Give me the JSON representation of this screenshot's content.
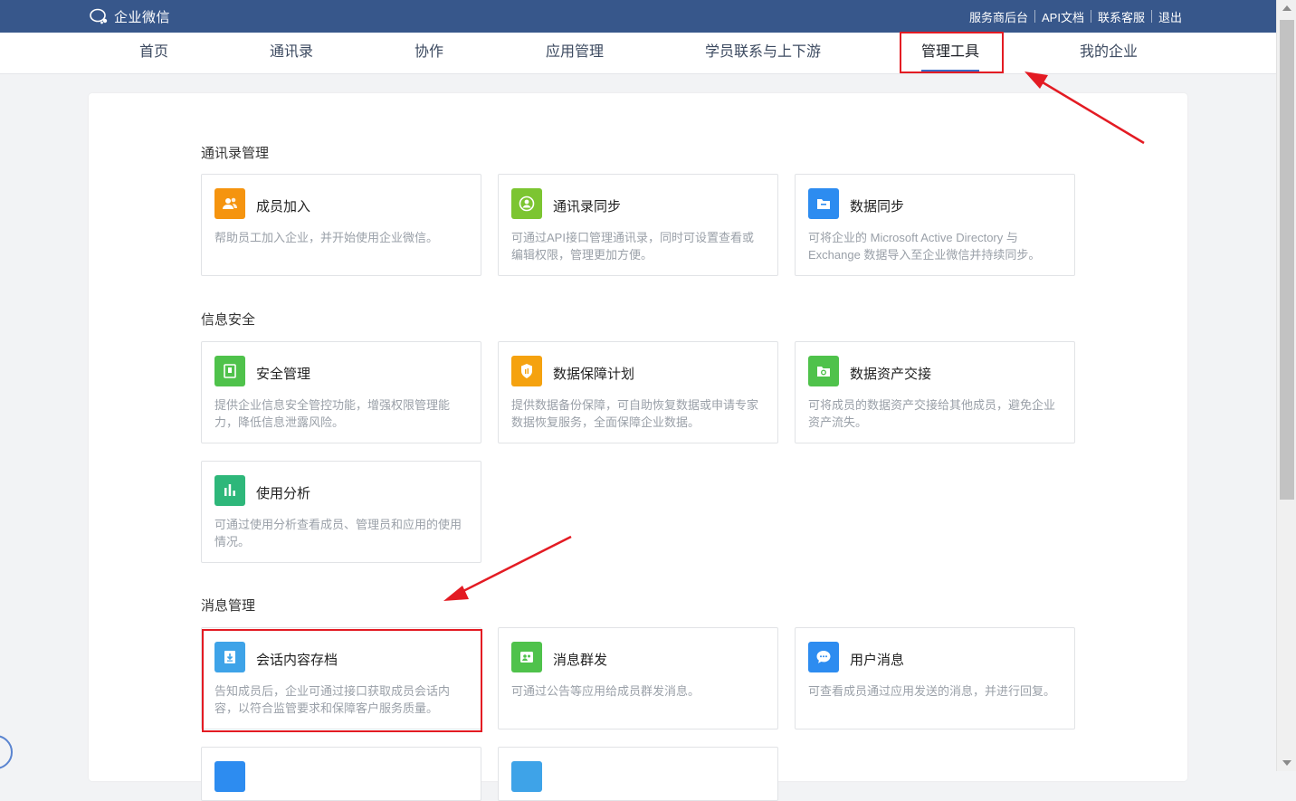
{
  "topbar": {
    "logo_text": "企业微信",
    "links": [
      "服务商后台",
      "API文档",
      "联系客服",
      "退出"
    ]
  },
  "nav": {
    "items": [
      "首页",
      "通讯录",
      "协作",
      "应用管理",
      "学员联系与上下游",
      "管理工具",
      "我的企业"
    ],
    "active": "管理工具"
  },
  "sections": {
    "contacts": {
      "title": "通讯录管理",
      "cards": [
        {
          "title": "成员加入",
          "desc": "帮助员工加入企业，并开始使用企业微信。",
          "icon": "member-join-icon",
          "color": "#f5940f"
        },
        {
          "title": "通讯录同步",
          "desc": "可通过API接口管理通讯录，同时可设置查看或编辑权限，管理更加方便。",
          "icon": "contact-sync-icon",
          "color": "#7cc531"
        },
        {
          "title": "数据同步",
          "desc": "可将企业的 Microsoft Active Directory 与 Exchange 数据导入至企业微信并持续同步。",
          "icon": "data-sync-icon",
          "color": "#2d8cf0"
        }
      ]
    },
    "security": {
      "title": "信息安全",
      "cards": [
        {
          "title": "安全管理",
          "desc": "提供企业信息安全管控功能，增强权限管理能力，降低信息泄露风险。",
          "icon": "security-icon",
          "color": "#4fc24b"
        },
        {
          "title": "数据保障计划",
          "desc": "提供数据备份保障，可自助恢复数据或申请专家数据恢复服务，全面保障企业数据。",
          "icon": "shield-icon",
          "color": "#f5a20f"
        },
        {
          "title": "数据资产交接",
          "desc": "可将成员的数据资产交接给其他成员，避免企业资产流失。",
          "icon": "asset-handover-icon",
          "color": "#4fc24b"
        },
        {
          "title": "使用分析",
          "desc": "可通过使用分析查看成员、管理员和应用的使用情况。",
          "icon": "bar-chart-icon",
          "color": "#2eb77a"
        }
      ]
    },
    "messages": {
      "title": "消息管理",
      "cards": [
        {
          "title": "会话内容存档",
          "desc": "告知成员后，企业可通过接口获取成员会话内容，以符合监管要求和保障客户服务质量。",
          "icon": "archive-icon",
          "color": "#3ea3e8"
        },
        {
          "title": "消息群发",
          "desc": "可通过公告等应用给成员群发消息。",
          "icon": "broadcast-icon",
          "color": "#4fc24b"
        },
        {
          "title": "用户消息",
          "desc": "可查看成员通过应用发送的消息，并进行回复。",
          "icon": "chat-bubble-icon",
          "color": "#2d8cf0"
        }
      ]
    }
  }
}
